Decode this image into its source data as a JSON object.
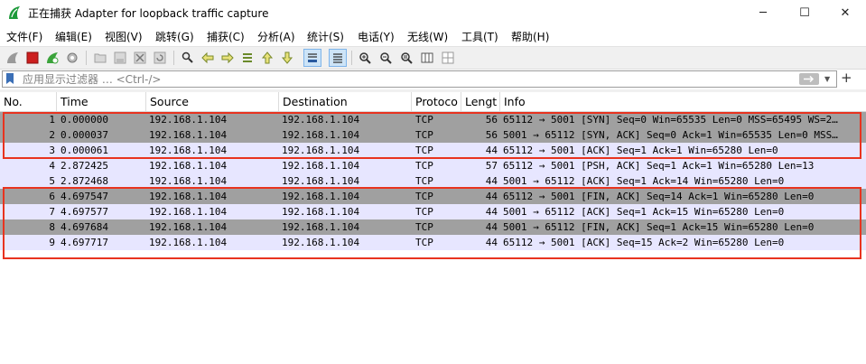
{
  "window": {
    "title": "正在捕获 Adapter for loopback traffic capture",
    "app_icon": "wireshark-fin-icon",
    "controls": {
      "minimize": "─",
      "maximize": "☐",
      "close": "✕"
    }
  },
  "menu": [
    "文件(F)",
    "编辑(E)",
    "视图(V)",
    "跳转(G)",
    "捕获(C)",
    "分析(A)",
    "统计(S)",
    "电话(Y)",
    "无线(W)",
    "工具(T)",
    "帮助(H)"
  ],
  "toolbar": {
    "icons": [
      "start-capture-icon",
      "stop-capture-icon",
      "restart-capture-icon",
      "capture-options-icon",
      "open-file-icon",
      "save-file-icon",
      "close-file-icon",
      "reload-file-icon",
      "find-packet-icon",
      "go-back-icon",
      "go-forward-icon",
      "go-to-packet-icon",
      "go-first-icon",
      "go-last-icon",
      "auto-scroll-icon",
      "colorize-icon",
      "zoom-in-icon",
      "zoom-out-icon",
      "normal-size-icon",
      "resize-columns-icon"
    ],
    "colors": {
      "stop": "#cc1f1f",
      "start_disabled": "#9a9a9a",
      "restart": "#3aa33a"
    }
  },
  "filter": {
    "placeholder": "应用显示过滤器 … <Ctrl-/>",
    "value": "",
    "add_label": "+"
  },
  "columns": [
    "No.",
    "Time",
    "Source",
    "Destination",
    "Protoco",
    "Lengt",
    "Info"
  ],
  "packets": [
    {
      "no": "1",
      "time": "0.000000",
      "source": "192.168.1.104",
      "destination": "192.168.1.104",
      "protocol": "TCP",
      "length": "56",
      "info": "65112 → 5001 [SYN] Seq=0 Win=65535 Len=0 MSS=65495 WS=2…",
      "style": "dark"
    },
    {
      "no": "2",
      "time": "0.000037",
      "source": "192.168.1.104",
      "destination": "192.168.1.104",
      "protocol": "TCP",
      "length": "56",
      "info": "5001 → 65112 [SYN, ACK] Seq=0 Ack=1 Win=65535 Len=0 MSS…",
      "style": "dark"
    },
    {
      "no": "3",
      "time": "0.000061",
      "source": "192.168.1.104",
      "destination": "192.168.1.104",
      "protocol": "TCP",
      "length": "44",
      "info": "65112 → 5001 [ACK] Seq=1 Ack=1 Win=65280 Len=0",
      "style": "light"
    },
    {
      "no": "4",
      "time": "2.872425",
      "source": "192.168.1.104",
      "destination": "192.168.1.104",
      "protocol": "TCP",
      "length": "57",
      "info": "65112 → 5001 [PSH, ACK] Seq=1 Ack=1 Win=65280 Len=13",
      "style": "light"
    },
    {
      "no": "5",
      "time": "2.872468",
      "source": "192.168.1.104",
      "destination": "192.168.1.104",
      "protocol": "TCP",
      "length": "44",
      "info": "5001 → 65112 [ACK] Seq=1 Ack=14 Win=65280 Len=0",
      "style": "light"
    },
    {
      "no": "6",
      "time": "4.697547",
      "source": "192.168.1.104",
      "destination": "192.168.1.104",
      "protocol": "TCP",
      "length": "44",
      "info": "65112 → 5001 [FIN, ACK] Seq=14 Ack=1 Win=65280 Len=0",
      "style": "dark"
    },
    {
      "no": "7",
      "time": "4.697577",
      "source": "192.168.1.104",
      "destination": "192.168.1.104",
      "protocol": "TCP",
      "length": "44",
      "info": "5001 → 65112 [ACK] Seq=1 Ack=15 Win=65280 Len=0",
      "style": "light"
    },
    {
      "no": "8",
      "time": "4.697684",
      "source": "192.168.1.104",
      "destination": "192.168.1.104",
      "protocol": "TCP",
      "length": "44",
      "info": "5001 → 65112 [FIN, ACK] Seq=1 Ack=15 Win=65280 Len=0",
      "style": "dark"
    },
    {
      "no": "9",
      "time": "4.697717",
      "source": "192.168.1.104",
      "destination": "192.168.1.104",
      "protocol": "TCP",
      "length": "44",
      "info": "65112 → 5001 [ACK] Seq=15 Ack=2 Win=65280 Len=0",
      "style": "light"
    }
  ],
  "colors": {
    "row_dark": "#a0a0a0",
    "row_light": "#e7e6ff",
    "highlight_box": "#e8331f"
  }
}
